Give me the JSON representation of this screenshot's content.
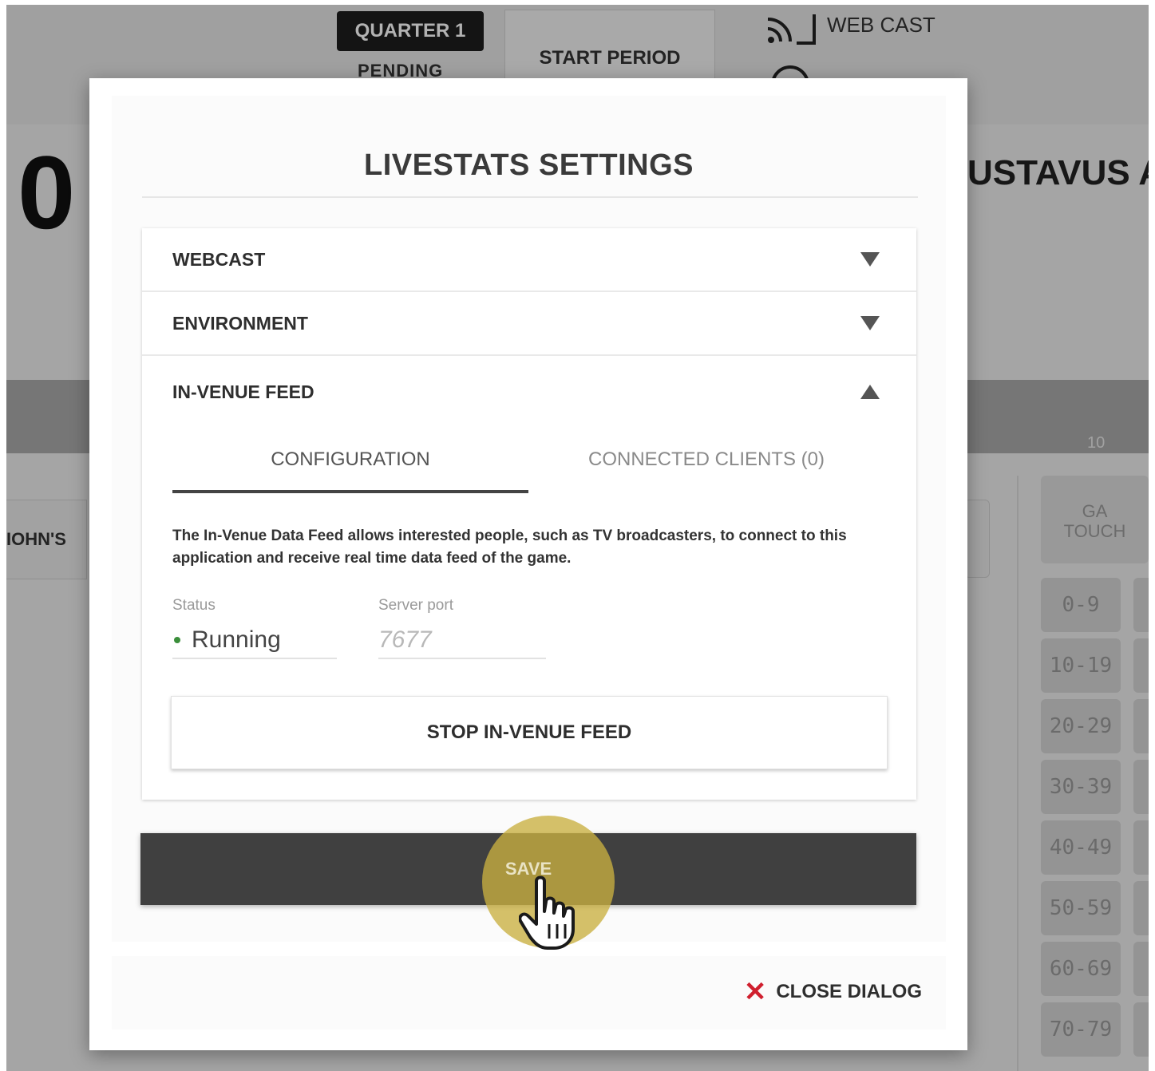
{
  "background": {
    "quarter_badge": "QUARTER 1",
    "quarter_status": "PENDING",
    "start_period": "START PERIOD",
    "webcast_label": "WEB CAST",
    "score": "0",
    "team_right": "USTAVUS A",
    "team_left": "IOHN'S",
    "band_text": "10",
    "ga_header": [
      "GA",
      "TOUCH"
    ],
    "ranges": [
      "0-9",
      "10-19",
      "20-29",
      "30-39",
      "40-49",
      "50-59",
      "60-69",
      "70-79"
    ]
  },
  "dialog": {
    "title": "LIVESTATS SETTINGS",
    "sections": [
      {
        "label": "WEBCAST",
        "expanded": false
      },
      {
        "label": "ENVIRONMENT",
        "expanded": false
      },
      {
        "label": "IN-VENUE FEED",
        "expanded": true
      }
    ],
    "tabs": [
      {
        "label": "CONFIGURATION",
        "active": true
      },
      {
        "label": "CONNECTED CLIENTS (0)",
        "active": false
      }
    ],
    "description": "The In-Venue Data Feed allows interested people, such as TV broadcasters, to connect to this application and receive real time data feed of the game.",
    "status": {
      "label": "Status",
      "value": "Running",
      "indicator_color": "#3a8e3a"
    },
    "server_port": {
      "label": "Server port",
      "value": "7677"
    },
    "stop_button": "STOP IN-VENUE FEED",
    "save_button": "SAVE",
    "close_button": "CLOSE DIALOG"
  },
  "colors": {
    "save_bg": "#404040",
    "highlight": "#c9b040",
    "close_icon": "#d01f2e"
  },
  "icons": [
    "webcast-icon",
    "person-icon",
    "chevron-down-icon",
    "chevron-up-icon",
    "status-dot-icon",
    "pointer-hand-icon",
    "close-icon"
  ]
}
